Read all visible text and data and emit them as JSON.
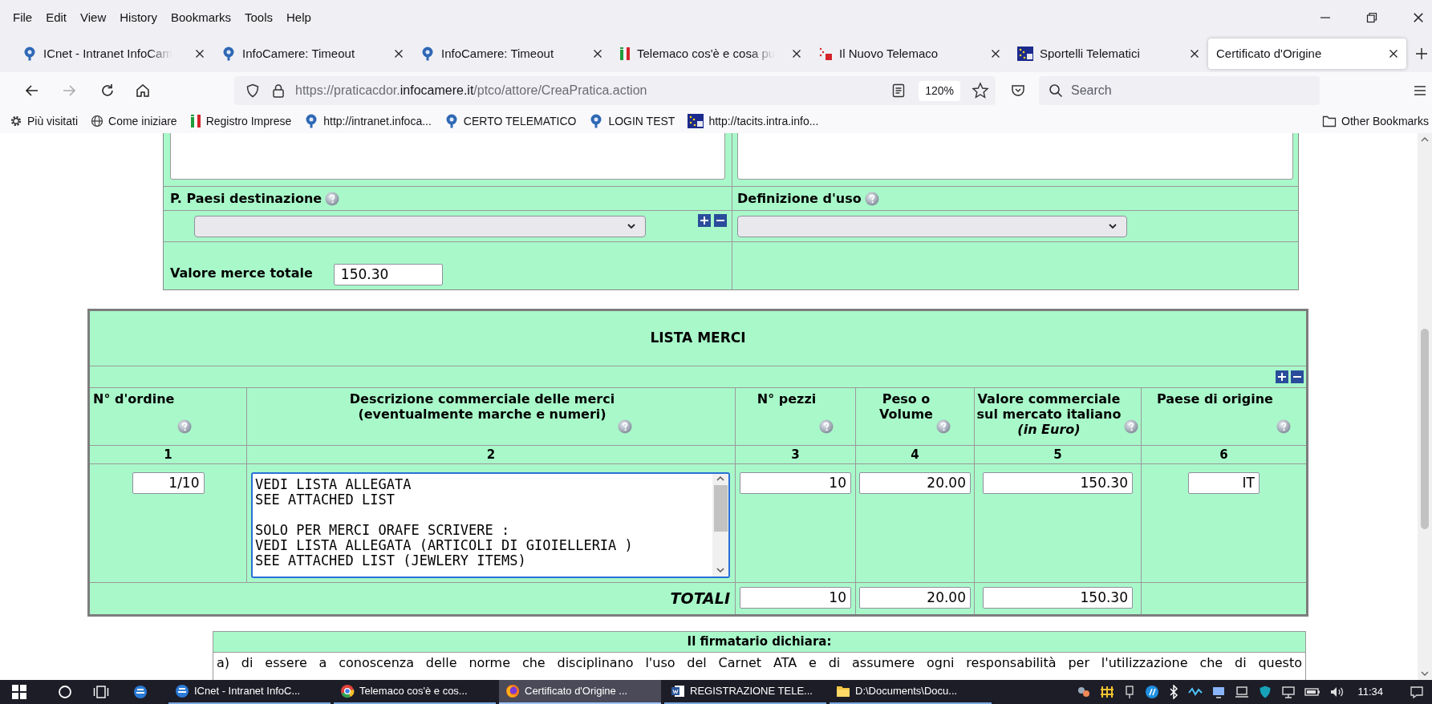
{
  "menu": [
    "File",
    "Edit",
    "View",
    "History",
    "Bookmarks",
    "Tools",
    "Help"
  ],
  "tabs": [
    {
      "label": "ICnet - Intranet InfoCam",
      "kind": "intranet",
      "faded": true,
      "selected": false
    },
    {
      "label": "InfoCamere: Timeout",
      "kind": "intranet",
      "faded": false,
      "selected": false
    },
    {
      "label": "InfoCamere: Timeout",
      "kind": "intranet",
      "faded": false,
      "selected": false
    },
    {
      "label": "Telemaco cos'è e cosa pu",
      "kind": "registro",
      "faded": true,
      "selected": false
    },
    {
      "label": "Il Nuovo Telemaco",
      "kind": "telemaco",
      "faded": false,
      "selected": false
    },
    {
      "label": "Sportelli Telematici",
      "kind": "sportelli",
      "faded": false,
      "selected": false
    },
    {
      "label": "Certificato d'Origine",
      "kind": "none",
      "faded": false,
      "selected": true
    }
  ],
  "address": {
    "prefix": "https://praticacdor.",
    "domain": "infocamere.it",
    "path": "/ptco/attore/CreaPratica.action",
    "zoom": "120%"
  },
  "search": {
    "placeholder": "Search"
  },
  "bookmarks": [
    {
      "label": "Più visitati",
      "kind": "gear"
    },
    {
      "label": "Come iniziare",
      "kind": "globe"
    },
    {
      "label": "Registro Imprese",
      "kind": "registro"
    },
    {
      "label": "http://intranet.infoca...",
      "kind": "intranet"
    },
    {
      "label": "CERTO TELEMATICO",
      "kind": "intranet"
    },
    {
      "label": "LOGIN TEST",
      "kind": "intranet"
    },
    {
      "label": "http://tacits.intra.info...",
      "kind": "sportelli"
    }
  ],
  "other_bookmarks": "Other Bookmarks",
  "form": {
    "destination_label": "P. Paesi destinazione",
    "use_label": "Definizione d'uso",
    "total_label": "Valore merce totale",
    "total_value": "150.30"
  },
  "goods": {
    "title": "LISTA MERCI",
    "columns": [
      {
        "heading": "N° d'ordine",
        "number": "1"
      },
      {
        "heading": "Descrizione commerciale delle merci\n(eventualmente marche e numeri)",
        "number": "2"
      },
      {
        "heading": "N° pezzi",
        "number": "3"
      },
      {
        "heading": "Peso o\nVolume",
        "number": "4"
      },
      {
        "heading": "Valore commerciale\nsul mercato italiano\n*(in Euro)*",
        "number": "5"
      },
      {
        "heading": "Paese di origine",
        "number": "6"
      }
    ],
    "row": {
      "order": "1/10",
      "description": "VEDI LISTA ALLEGATA\nSEE ATTACHED LIST\n\nSOLO PER MERCI ORAFE SCRIVERE :\nVEDI LISTA ALLEGATA (ARTICOLI DI GIOIELLERIA )\nSEE ATTACHED LIST (JEWLERY ITEMS)",
      "pieces": "10",
      "weight": "20.00",
      "value": "150.30",
      "origin": "IT"
    },
    "totals": {
      "label": "TOTALI",
      "pieces": "10",
      "weight": "20.00",
      "value": "150.30"
    }
  },
  "declaration": {
    "title": "Il firmatario dichiara:",
    "text": "a) di essere a conoscenza delle norme che disciplinano l'uso del Carnet ATA e di assumere ogni responsabilità per l'utilizzazione che di questo"
  },
  "taskbar": {
    "windows": [
      {
        "label": "ICnet - Intranet InfoC...",
        "kind": "edge",
        "selected": false
      },
      {
        "label": "Telemaco cos'è e cos...",
        "kind": "chrome",
        "selected": false
      },
      {
        "label": "Certificato d'Origine ...",
        "kind": "firefox",
        "selected": true
      },
      {
        "label": "REGISTRAZIONE TELE...",
        "kind": "word",
        "selected": false
      },
      {
        "label": "D:\\Documents\\Docu...",
        "kind": "folder",
        "selected": false
      }
    ],
    "clock": "11:34"
  }
}
